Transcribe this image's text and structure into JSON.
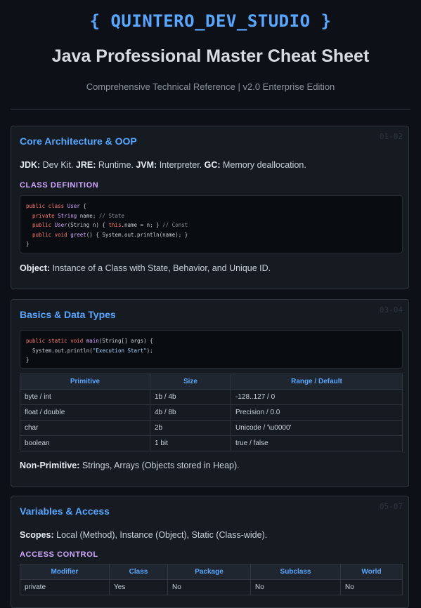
{
  "header": {
    "brand": "{ QUINTERO_DEV_STUDIO }",
    "title": "Java Professional Master Cheat Sheet",
    "subtitle": "Comprehensive Technical Reference | v2.0 Enterprise Edition"
  },
  "sections": {
    "core": {
      "title": "Core Architecture & OOP",
      "num": "01-02",
      "intro": {
        "jdk_label": "JDK:",
        "jdk_text": " Dev Kit. ",
        "jre_label": "JRE:",
        "jre_text": " Runtime. ",
        "jvm_label": "JVM:",
        "jvm_text": " Interpreter. ",
        "gc_label": "GC:",
        "gc_text": " Memory deallocation."
      },
      "subheading": "CLASS DEFINITION",
      "code": {
        "l1a": "public class ",
        "l1b": "User",
        "l1c": " {",
        "l2a": "  private ",
        "l2b": "String",
        "l2c": " name; ",
        "l2d": "// State",
        "l3a": "  public ",
        "l3b": "User",
        "l3c": "(String n) { ",
        "l3d": "this",
        "l3e": ".name = n; } ",
        "l3f": "// Const",
        "l4a": "  public void ",
        "l4b": "greet",
        "l4c": "() { System.out.println(name); }",
        "l5": "}"
      },
      "outro_label": "Object:",
      "outro_text": " Instance of a Class with State, Behavior, and Unique ID."
    },
    "basics": {
      "title": "Basics & Data Types",
      "num": "03-04",
      "code": {
        "l1a": "public static void ",
        "l1b": "main",
        "l1c": "(String[] args) {",
        "l2a": "  System.out.println(",
        "l2b": "\"Execution Start\"",
        "l2c": ");",
        "l3": "}"
      },
      "table": {
        "headers": [
          "Primitive",
          "Size",
          "Range / Default"
        ],
        "rows": [
          [
            "byte / int",
            "1b / 4b",
            "-128..127 / 0"
          ],
          [
            "float / double",
            "4b / 8b",
            "Precision / 0.0"
          ],
          [
            "char",
            "2b",
            "Unicode / '\\u0000'"
          ],
          [
            "boolean",
            "1 bit",
            "true / false"
          ]
        ]
      },
      "outro_label": "Non-Primitive:",
      "outro_text": " Strings, Arrays (Objects stored in Heap)."
    },
    "variables": {
      "title": "Variables & Access",
      "num": "05-07",
      "scopes_label": "Scopes:",
      "scopes_text": " Local (Method), Instance (Object), Static (Class-wide).",
      "subheading": "ACCESS CONTROL",
      "table": {
        "headers": [
          "Modifier",
          "Class",
          "Package",
          "Subclass",
          "World"
        ],
        "rows": [
          [
            "private",
            "Yes",
            "No",
            "No",
            "No"
          ]
        ]
      }
    }
  }
}
